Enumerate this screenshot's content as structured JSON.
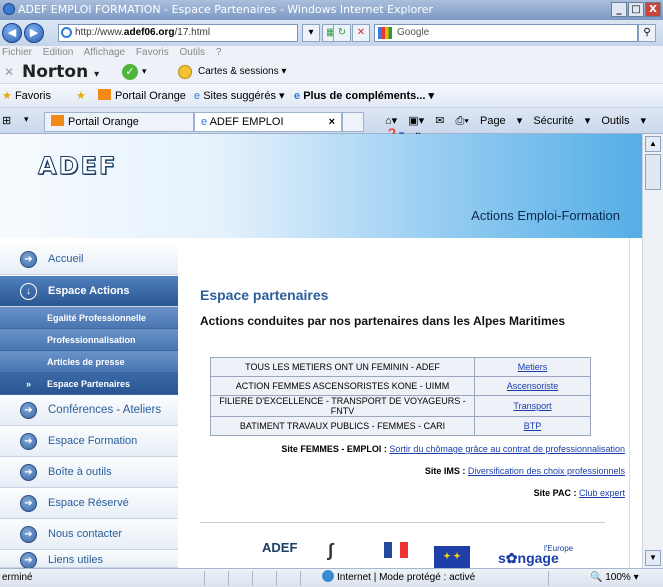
{
  "window": {
    "title": "ADEF EMPLOI FORMATION - Espace Partenaires - Windows Internet Explorer"
  },
  "address": {
    "url_prefix": "http://www.",
    "url_domain": "adef06.org",
    "url_path": "/17.html"
  },
  "search": {
    "placeholder": "Google"
  },
  "menu": [
    "Fichier",
    "Edition",
    "Affichage",
    "Favoris",
    "Outils",
    "?"
  ],
  "norton": {
    "brand": "Norton",
    "cards_label": "Cartes & sessions"
  },
  "favorites": {
    "label": "Favoris",
    "portail": "Portail Orange",
    "sites": "Sites suggérés",
    "plus": "Plus de compléments..."
  },
  "tabs": [
    {
      "label": "Portail Orange"
    },
    {
      "label": "ADEF EMPLOI FORMATI..."
    }
  ],
  "toolbar": {
    "page": "Page",
    "securite": "Sécurité",
    "outils": "Outils"
  },
  "banner": {
    "logo": "ADEF",
    "tagline": "Actions Emploi-Formation"
  },
  "sidebar": {
    "items": [
      {
        "label": "Accueil"
      },
      {
        "label": "Espace Actions"
      },
      {
        "label": "Conférences - Ateliers"
      },
      {
        "label": "Espace Formation"
      },
      {
        "label": "Boîte à outils"
      },
      {
        "label": "Espace Réservé"
      },
      {
        "label": "Nous contacter"
      },
      {
        "label": "Liens utiles"
      }
    ],
    "subitems": [
      {
        "label": "Egalité Professionnelle"
      },
      {
        "label": "Professionnalisation"
      },
      {
        "label": "Articles de presse"
      },
      {
        "label": "Espace Partenaires"
      }
    ]
  },
  "main": {
    "title": "Espace partenaires",
    "subtitle": "Actions conduites par nos partenaires dans les Alpes Maritimes",
    "table": [
      {
        "action": "TOUS LES METIERS ONT UN FEMININ - ADEF",
        "link": "Metiers"
      },
      {
        "action": "ACTION FEMMES ASCENSORISTES KONE - UIMM",
        "link": "Ascensoriste"
      },
      {
        "action": "FILIERE D'EXCELLENCE - TRANSPORT DE VOYAGEURS - FNTV",
        "link": "Transport"
      },
      {
        "action": "BATIMENT TRAVAUX PUBLICS - FEMMES - CARI",
        "link": "BTP"
      }
    ],
    "sites": [
      {
        "label": "Site FEMMES - EMPLOI :",
        "link": "Sortir du chômage grâce au contrat de professionnalisation"
      },
      {
        "label": "Site IMS :",
        "link": "Diversification des choix professionnels"
      },
      {
        "label": "Site PAC :",
        "link": "Club expert"
      }
    ],
    "footer_logos": {
      "adef": "ADEF",
      "europe": "l'Europe"
    }
  },
  "status": {
    "left": "erminé",
    "zone": "Internet | Mode protégé : activé",
    "zoom": "100%"
  }
}
